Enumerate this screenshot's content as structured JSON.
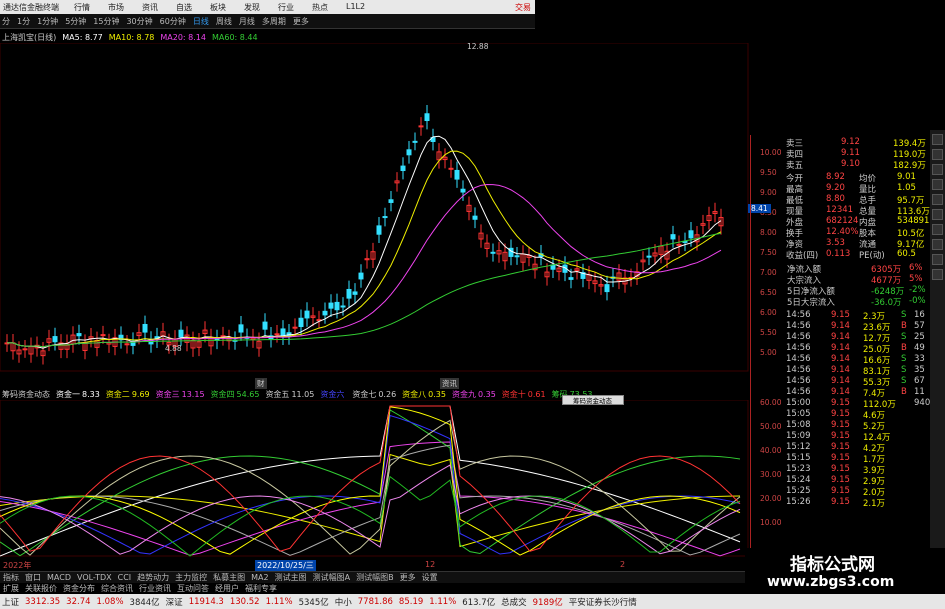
{
  "app": {
    "title": "通达信金融终端",
    "broker": "交易",
    "menu": [
      "行情",
      "市场",
      "资讯",
      "自选",
      "板块",
      "发现",
      "行业",
      "热点",
      "L1L2"
    ]
  },
  "periods": {
    "items": [
      "1分",
      "1分钟",
      "5分钟",
      "15分钟",
      "30分钟",
      "60分钟",
      "日线",
      "周线",
      "月线",
      "多周期",
      "更多"
    ],
    "active": "日线",
    "prefix": "分"
  },
  "chart_header": {
    "name": "上海凯宝(日线)",
    "ma5": "MA5: 8.77",
    "ma10": "MA10: 8.78",
    "ma20": "MA20: 8.14",
    "ma60": "MA60: 8.44"
  },
  "price": {
    "high_label": "12.88",
    "low_label": "4.88",
    "axis": [
      "10.00",
      "9.50",
      "9.00",
      "8.50",
      "8.00",
      "7.50",
      "7.00",
      "6.50",
      "6.00",
      "5.50",
      "5.00"
    ],
    "current_tag": "8.41",
    "labels_center": [
      "财",
      "资讯"
    ]
  },
  "indicator": {
    "name": "筹码资金动态",
    "items": [
      [
        "资金一",
        "8.33"
      ],
      [
        "资金二",
        "9.69"
      ],
      [
        "资金三",
        "13.15"
      ],
      [
        "资金四",
        "54.65"
      ],
      [
        "资金五",
        "11.05"
      ],
      [
        "资金六",
        ""
      ],
      [
        "资金七",
        "0.26"
      ],
      [
        "资金八",
        "0.35"
      ],
      [
        "资金九",
        "0.35"
      ],
      [
        "资金十",
        "0.61"
      ],
      [
        "筹码",
        "73.53"
      ]
    ],
    "axis": [
      "60.00",
      "50.00",
      "40.00",
      "30.00",
      "20.00",
      "10.00"
    ],
    "popup": "筹码资金动态"
  },
  "dates": {
    "start": "2022年",
    "mid": "2022/10/25/三",
    "m12": "12",
    "m2": "2"
  },
  "bottom_tabs": [
    "指标",
    "窗口",
    "MACD",
    "VOL-TDX",
    "CCI",
    "趋势动力",
    "主力监控",
    "私募主图",
    "MA2",
    "测试主图",
    "测试幅图A",
    "测试幅图B",
    "更多",
    "设置"
  ],
  "bottom_tabs2": [
    "扩展",
    "关联报价",
    "资金分布",
    "综合资讯",
    "行业资讯",
    "互动问答",
    "经用户",
    "福利专享"
  ],
  "quotes": {
    "asks": [
      [
        "卖三",
        "9.12",
        "139.4万"
      ],
      [
        "卖四",
        "9.11",
        "119.0万"
      ],
      [
        "卖五",
        "9.10",
        "182.9万"
      ]
    ],
    "stats": [
      [
        "今开",
        "8.92",
        "均价",
        "9.01"
      ],
      [
        "最高",
        "9.20",
        "量比",
        "1.05"
      ],
      [
        "最低",
        "8.80",
        "总手",
        "95.7万"
      ],
      [
        "现量",
        "12341",
        "总量",
        "113.6万"
      ],
      [
        "外盘",
        "682124",
        "内盘",
        "534891"
      ],
      [
        "换手",
        "12.40%",
        "股本",
        "10.5亿"
      ],
      [
        "净资",
        "3.53",
        "流通",
        "9.17亿"
      ],
      [
        "收益(四)",
        "0.113",
        "PE(动)",
        "60.5"
      ]
    ],
    "flows": [
      [
        "净流入额",
        "6305万",
        "6%"
      ],
      [
        "大宗流入",
        "4677万",
        "5%"
      ],
      [
        "5日净流入额",
        "-6248万",
        "-2%"
      ],
      [
        "5日大宗流入",
        "-36.0万",
        "-0%"
      ]
    ],
    "ticks": [
      [
        "14:56",
        "9.15",
        "2.3万",
        "S",
        "16"
      ],
      [
        "14:56",
        "9.14",
        "23.6万",
        "B",
        "57"
      ],
      [
        "14:56",
        "9.14",
        "12.7万",
        "S",
        "25"
      ],
      [
        "14:56",
        "9.14",
        "25.0万",
        "B",
        "49"
      ],
      [
        "14:56",
        "9.14",
        "16.6万",
        "S",
        "33"
      ],
      [
        "14:56",
        "9.14",
        "83.1万",
        "S",
        "35"
      ],
      [
        "14:56",
        "9.14",
        "55.3万",
        "S",
        "67"
      ],
      [
        "14:56",
        "9.14",
        "7.4万",
        "B",
        "11"
      ],
      [
        "15:00",
        "9.15",
        "112.0万",
        "",
        "940"
      ],
      [
        "15:05",
        "9.15",
        "4.6万",
        "",
        " "
      ],
      [
        "15:08",
        "9.15",
        "5.2万",
        "",
        " "
      ],
      [
        "15:09",
        "9.15",
        "12.4万",
        "",
        " "
      ],
      [
        "15:12",
        "9.15",
        "4.2万",
        "",
        " "
      ],
      [
        "15:15",
        "9.15",
        "1.7万",
        "",
        " "
      ],
      [
        "15:23",
        "9.15",
        "3.9万",
        "",
        " "
      ],
      [
        "15:24",
        "9.15",
        "2.9万",
        "",
        " "
      ],
      [
        "15:25",
        "9.15",
        "2.0万",
        "",
        " "
      ],
      [
        "15:26",
        "9.15",
        "2.1万",
        "",
        " "
      ]
    ]
  },
  "status": {
    "items": [
      [
        "上证",
        "3312.35",
        "32.74",
        "1.08%",
        "3844亿"
      ],
      [
        "深证",
        "11914.3",
        "130.52",
        "1.11%",
        "5345亿"
      ],
      [
        "中小",
        "7781.86",
        "85.19",
        "1.11%",
        "613.7亿"
      ],
      [
        "总成交",
        "9189亿",
        "",
        "",
        " "
      ]
    ],
    "broker": "平安证券长沙行情"
  },
  "watermark": {
    "line1": "指标公式网",
    "line2": "www.zbgs3.com"
  }
}
